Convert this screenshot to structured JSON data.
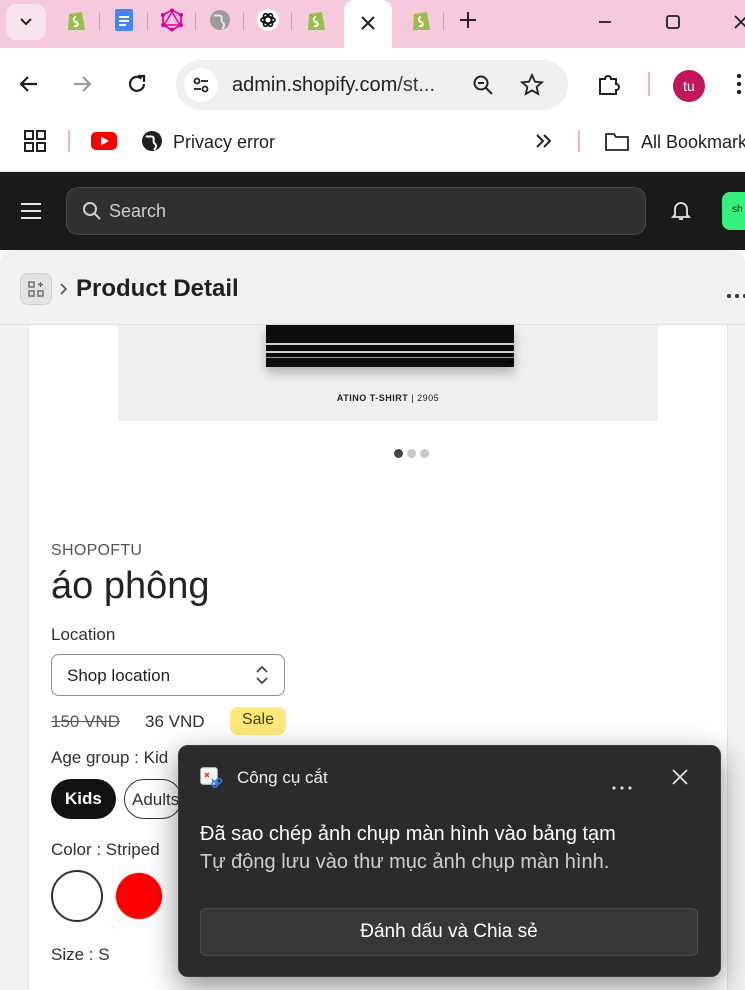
{
  "browser": {
    "tabs": [
      {
        "icon": "shopify-icon"
      },
      {
        "icon": "google-docs-icon"
      },
      {
        "icon": "graphql-icon"
      },
      {
        "icon": "globe-icon"
      },
      {
        "icon": "openai-icon"
      },
      {
        "icon": "shopify-icon"
      },
      {
        "icon": "close-icon",
        "active": true
      },
      {
        "icon": "shopify-icon"
      }
    ],
    "url_host": "admin.shopify.com",
    "url_rest": "/st...",
    "profile_initials": "tu",
    "bookmarks": {
      "privacy_error": "Privacy error",
      "all_bookmarks": "All Bookmark"
    }
  },
  "shopify": {
    "search_placeholder": "Search",
    "green_badge": "sh"
  },
  "page": {
    "title": "Product Detail"
  },
  "product": {
    "image_caption_brand": "ATINO T-SHIRT",
    "image_caption_code": "| 2905",
    "vendor": "SHOPOFTU",
    "title": "áo phông",
    "location_label": "Location",
    "location_value": "Shop location",
    "price_compare": "150 VND",
    "price": "36 VND",
    "sale_badge": "Sale",
    "age_group_label": "Age group : Kid",
    "age_options": [
      "Kids",
      "Adults"
    ],
    "color_label": "Color : Striped",
    "colors": [
      "#ffffff",
      "#ff0000"
    ],
    "size_label": "Size : S"
  },
  "toast": {
    "app_name": "Công cụ cắt",
    "title": "Đã sao chép ảnh chụp màn hình vào bảng tạm",
    "body": "Tự động lưu vào thư mục ảnh chụp màn hình.",
    "action": "Đánh dấu và Chia sẻ"
  }
}
